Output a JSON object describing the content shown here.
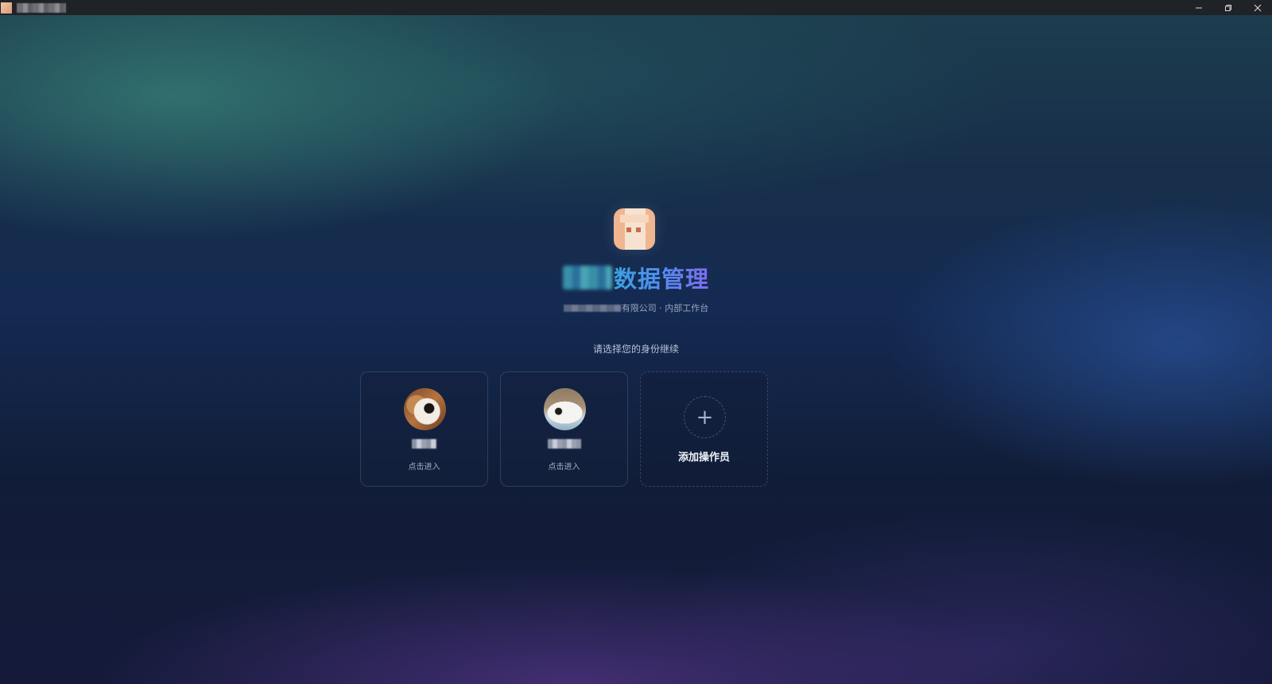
{
  "window": {
    "title": "",
    "controls": {
      "minimize": "—",
      "restore": "❐",
      "close": "✕"
    }
  },
  "header": {
    "logo_icon": "app-logo",
    "title_suffix": "数据管理",
    "subtitle_suffix": "有限公司 · 内部工作台"
  },
  "prompt": "请选择您的身份继续",
  "operators": [
    {
      "name": "",
      "action_label": "点击进入",
      "avatar_icon": "user-avatar"
    },
    {
      "name": "",
      "action_label": "点击进入",
      "avatar_icon": "user-avatar"
    }
  ],
  "add_operator": {
    "icon": "+",
    "label": "添加操作员"
  },
  "colors": {
    "title_gradient_start": "#3aa1e0",
    "title_gradient_end": "#7f6cf0",
    "background": "#0f1a33"
  }
}
